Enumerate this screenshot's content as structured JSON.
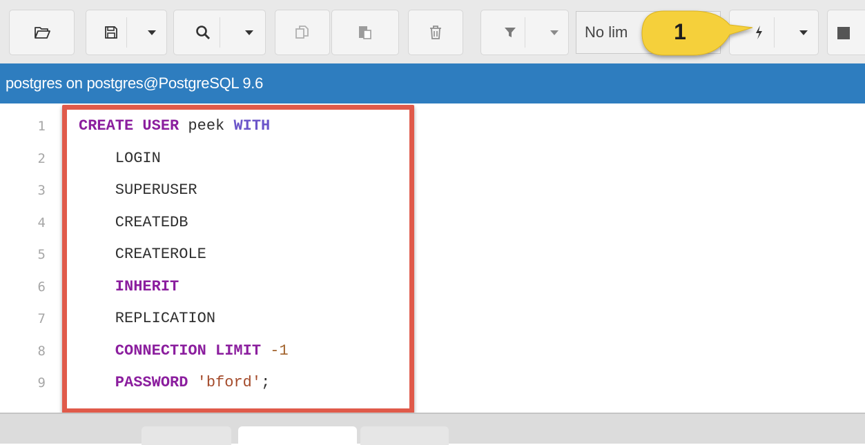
{
  "toolbar": {
    "buttons": [
      {
        "name": "open-file-button",
        "icon": "folder-open-icon"
      },
      {
        "name": "save-button",
        "icon": "save-icon"
      },
      {
        "name": "find-button",
        "icon": "search-icon"
      },
      {
        "name": "copy-button",
        "icon": "copy-icon"
      },
      {
        "name": "paste-button",
        "icon": "paste-icon"
      },
      {
        "name": "delete-button",
        "icon": "trash-icon"
      },
      {
        "name": "filter-button",
        "icon": "filter-icon"
      },
      {
        "name": "execute-button",
        "icon": "lightning-icon"
      },
      {
        "name": "stop-button",
        "icon": "stop-icon"
      }
    ],
    "limit_select_value": "No lim"
  },
  "callout": {
    "number": "1",
    "color": "#f5d03a"
  },
  "title": "postgres on postgres@PostgreSQL 9.6",
  "editor": {
    "line_numbers": [
      "1",
      "2",
      "3",
      "4",
      "5",
      "6",
      "7",
      "8",
      "9"
    ],
    "lines": [
      [
        {
          "t": "CREATE USER",
          "c": "kw"
        },
        {
          "t": " peek ",
          "c": "plain"
        },
        {
          "t": "WITH",
          "c": "kw2"
        }
      ],
      [
        {
          "t": "    LOGIN",
          "c": "plain"
        }
      ],
      [
        {
          "t": "    SUPERUSER",
          "c": "plain"
        }
      ],
      [
        {
          "t": "    CREATEDB",
          "c": "plain"
        }
      ],
      [
        {
          "t": "    CREATEROLE",
          "c": "plain"
        }
      ],
      [
        {
          "t": "    INHERIT",
          "c": "kw"
        }
      ],
      [
        {
          "t": "    REPLICATION",
          "c": "plain"
        }
      ],
      [
        {
          "t": "    CONNECTION LIMIT",
          "c": "kw"
        },
        {
          "t": " ",
          "c": "plain"
        },
        {
          "t": "-1",
          "c": "num"
        }
      ],
      [
        {
          "t": "    PASSWORD",
          "c": "kw"
        },
        {
          "t": " ",
          "c": "plain"
        },
        {
          "t": "'bford'",
          "c": "str"
        },
        {
          "t": ";",
          "c": "plain"
        }
      ]
    ]
  },
  "colors": {
    "title_bar": "#2e7dbf",
    "highlight_border": "#e05a4a",
    "keyword": "#8b1e9e",
    "keyword_alt": "#6b55c9",
    "number": "#a1612a",
    "string": "#a44b2b"
  }
}
